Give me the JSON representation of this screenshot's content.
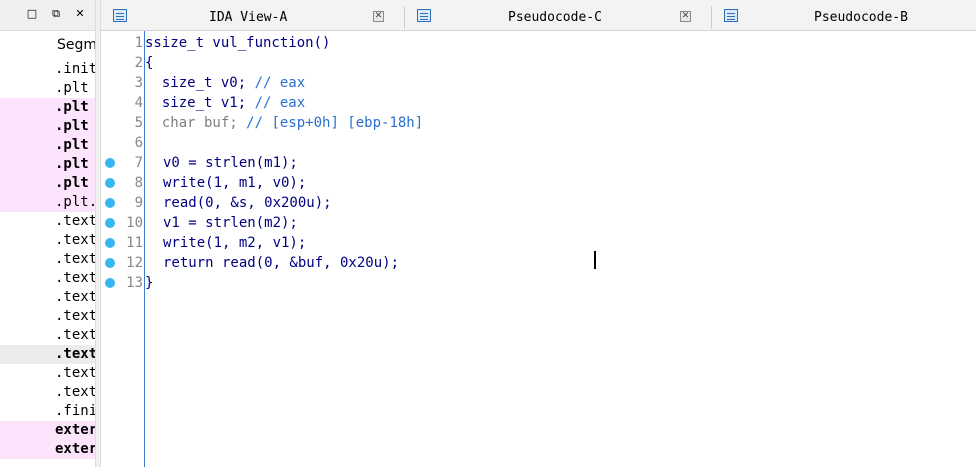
{
  "left_panel": {
    "toolbar": {
      "restore": "□",
      "float": "⧉",
      "close": "✕"
    },
    "header": "Segm",
    "segments": [
      ".init",
      ".plt",
      ".plt",
      ".plt",
      ".plt",
      ".plt",
      ".plt",
      ".plt.",
      ".text",
      ".text",
      ".text",
      ".text",
      ".text",
      ".text",
      ".text",
      ".text",
      ".text",
      ".text",
      ".fini",
      "exter",
      "exter"
    ]
  },
  "tabs": [
    {
      "label": "IDA View-A",
      "icon": "disassembly-icon",
      "close": "✕"
    },
    {
      "label": "Pseudocode-C",
      "icon": "pseudocode-icon",
      "close": "✕"
    },
    {
      "label": "Pseudocode-B",
      "icon": "pseudocode-icon"
    }
  ],
  "code": {
    "lines": [
      {
        "num": "1",
        "text": "ssize_t vul_function()"
      },
      {
        "num": "2",
        "text": "{"
      },
      {
        "num": "3",
        "decl": "size_t v0;",
        "comment": "// eax"
      },
      {
        "num": "4",
        "decl": "size_t v1;",
        "comment": "// eax"
      },
      {
        "num": "5",
        "decl": "char buf;",
        "comment": "// [esp+0h] [ebp-18h]"
      },
      {
        "num": "6",
        "text": ""
      },
      {
        "num": "7",
        "text": "v0 = strlen(m1);"
      },
      {
        "num": "8",
        "text": "write(1, m1, v0);"
      },
      {
        "num": "9",
        "text": "read(0, &s, 0x200u);"
      },
      {
        "num": "10",
        "text": "v1 = strlen(m2);"
      },
      {
        "num": "11",
        "text": "write(1, m2, v1);"
      },
      {
        "num": "12",
        "text": "return read(0, &buf, 0x20u);"
      },
      {
        "num": "13",
        "text": "}"
      }
    ]
  },
  "colors": {
    "breakpoint": "#39b6f0",
    "pink_row": "#fce4fc",
    "gutter_line": "#3b7fd0"
  }
}
